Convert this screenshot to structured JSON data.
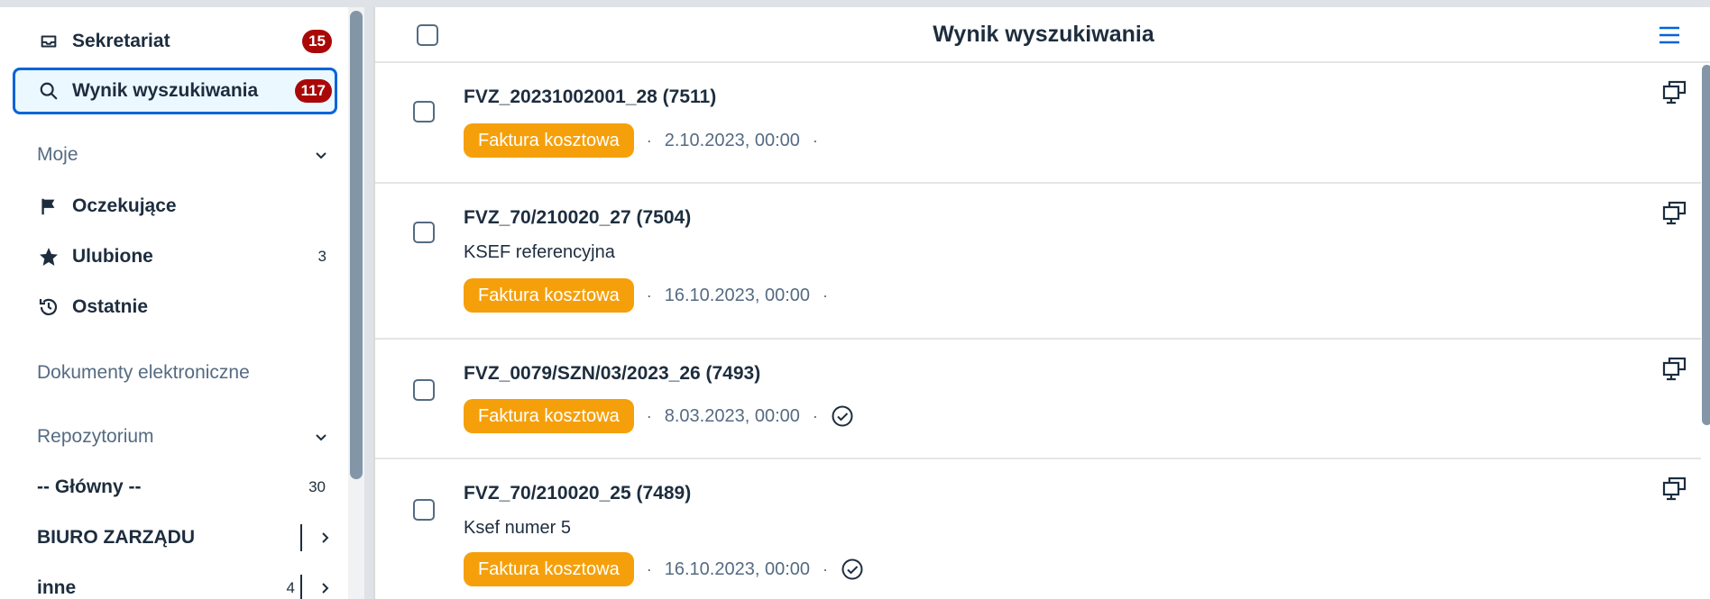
{
  "sidebar": {
    "items": [
      {
        "label": "Sekretariat",
        "badge": "15",
        "icon": "inbox-icon"
      },
      {
        "label": "Wynik wyszukiwania",
        "badge": "117",
        "icon": "search-icon"
      }
    ],
    "group_moje": {
      "label": "Moje"
    },
    "moje_items": [
      {
        "label": "Oczekujące",
        "count": "",
        "icon": "flag-icon"
      },
      {
        "label": "Ulubione",
        "count": "3",
        "icon": "star-icon"
      },
      {
        "label": "Ostatnie",
        "count": "",
        "icon": "history-icon"
      }
    ],
    "section_electronic": {
      "label": "Dokumenty elektroniczne"
    },
    "group_repo": {
      "label": "Repozytorium"
    },
    "repo_items": [
      {
        "label": "-- Główny --",
        "count": "30"
      },
      {
        "label": "BIURO ZARZĄDU",
        "count": ""
      },
      {
        "label": "inne",
        "count": "4"
      }
    ]
  },
  "main": {
    "title": "Wynik wyszukiwania",
    "rows": [
      {
        "title": "FVZ_20231002001_28 (7511)",
        "subtitle": "",
        "tag": "Faktura kosztowa",
        "date": "2.10.2023, 00:00",
        "status": ""
      },
      {
        "title": "FVZ_70/210020_27 (7504)",
        "subtitle": "KSEF referencyjna",
        "tag": "Faktura kosztowa",
        "date": "16.10.2023, 00:00",
        "status": ""
      },
      {
        "title": "FVZ_0079/SZN/03/2023_26 (7493)",
        "subtitle": "",
        "tag": "Faktura kosztowa",
        "date": "8.03.2023, 00:00",
        "status": "check-circle-icon"
      },
      {
        "title": "FVZ_70/210020_25 (7489)",
        "subtitle": "Ksef numer 5",
        "tag": "Faktura kosztowa",
        "date": "16.10.2023, 00:00",
        "status": "check-circle-icon"
      }
    ],
    "separator": "·"
  },
  "colors": {
    "accent": "#0064d9",
    "badge": "#aa0808",
    "tag": "#f5a00b",
    "muted": "#556b82"
  }
}
